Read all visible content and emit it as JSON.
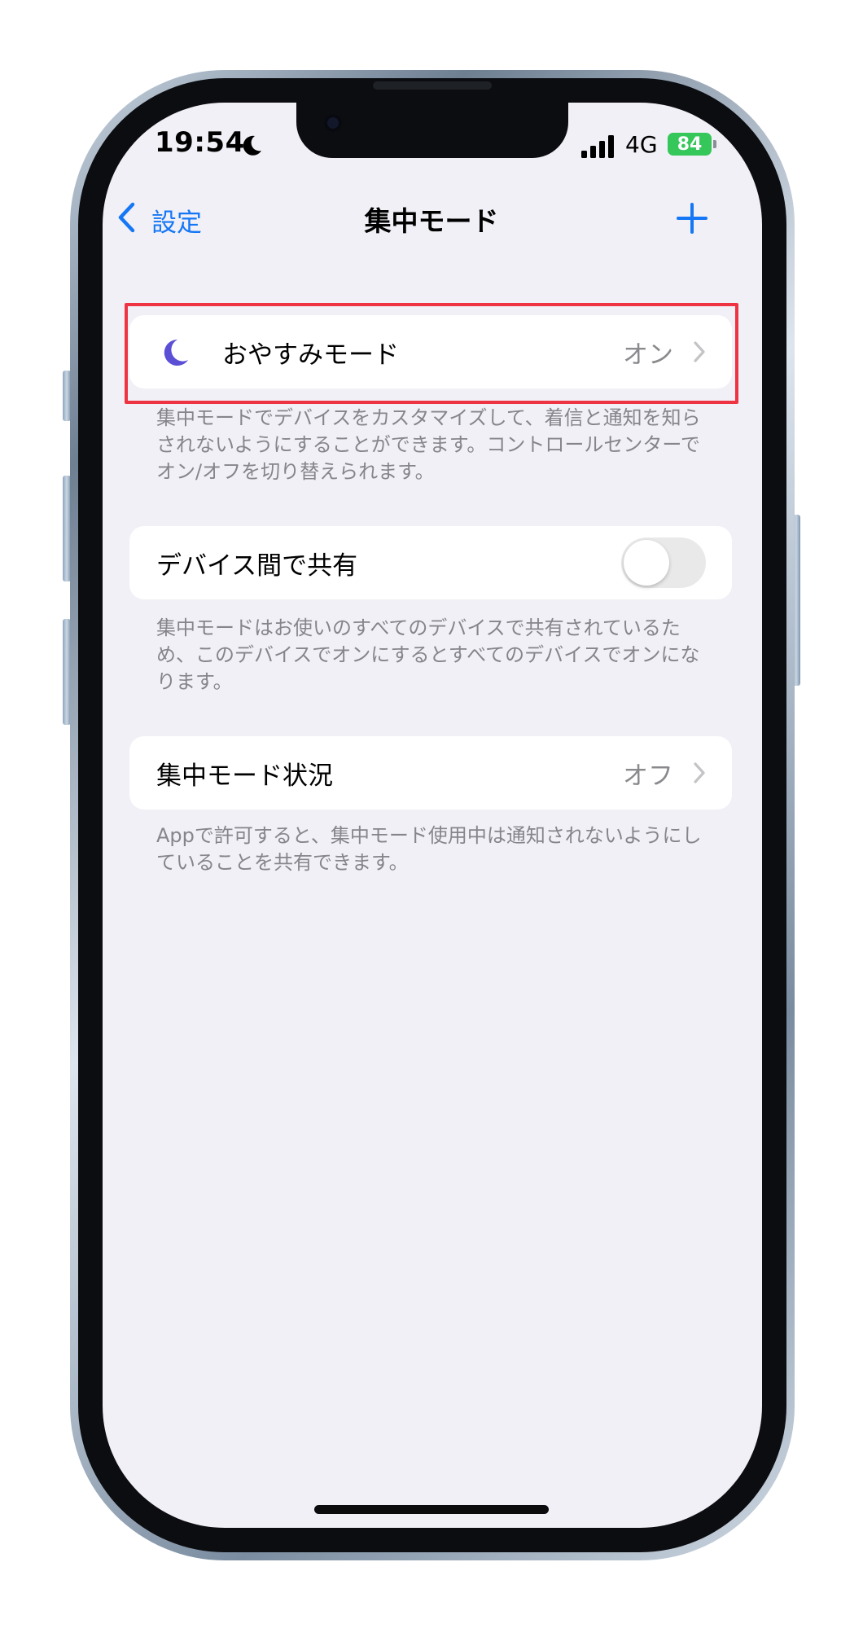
{
  "status_bar": {
    "time": "19:54",
    "network": "4G",
    "battery": "84"
  },
  "nav": {
    "back_label": "設定",
    "title": "集中モード"
  },
  "focus_list": {
    "items": [
      {
        "label": "おやすみモード",
        "value": "オン",
        "icon": "moon-icon",
        "icon_color": "#5b4fd6"
      }
    ],
    "footer": "集中モードでデバイスをカスタマイズして、着信と通知を知らされないようにすることができます。コントロールセンターでオン/オフを切り替えられます。"
  },
  "share_across_devices": {
    "label": "デバイス間で共有",
    "enabled": false,
    "footer": "集中モードはお使いのすべてのデバイスで共有されているため、このデバイスでオンにするとすべてのデバイスでオンになります。"
  },
  "focus_status": {
    "label": "集中モード状況",
    "value": "オフ",
    "footer": "Appで許可すると、集中モード使用中は通知されないようにしていることを共有できます。"
  },
  "colors": {
    "accent": "#1577f5",
    "highlight": "#ee3443",
    "battery": "#35c759"
  }
}
